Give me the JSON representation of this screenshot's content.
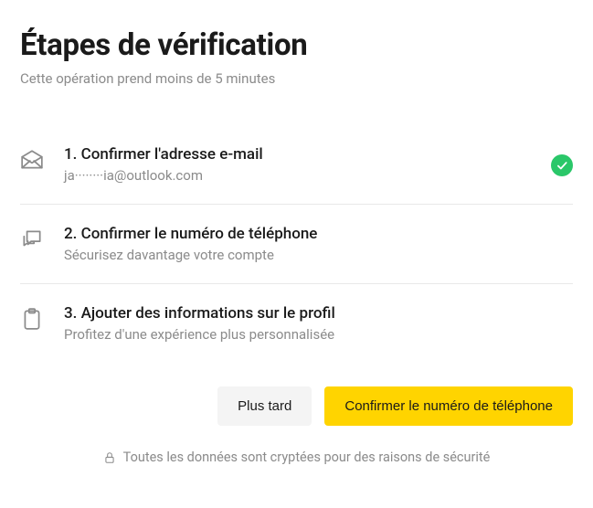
{
  "header": {
    "title": "Étapes de vérification",
    "subtitle": "Cette opération prend moins de 5 minutes"
  },
  "steps": [
    {
      "title": "1. Confirmer l'adresse e-mail",
      "desc": "ja········ia@outlook.com",
      "completed": true
    },
    {
      "title": "2. Confirmer le numéro de téléphone",
      "desc": "Sécurisez davantage votre compte",
      "completed": false
    },
    {
      "title": "3. Ajouter des informations sur le profil",
      "desc": "Profitez d'une expérience plus personnalisée",
      "completed": false
    }
  ],
  "buttons": {
    "later": "Plus tard",
    "confirm": "Confirmer le numéro de téléphone"
  },
  "footer": {
    "text": "Toutes les données sont cryptées pour des raisons de sécurité"
  }
}
